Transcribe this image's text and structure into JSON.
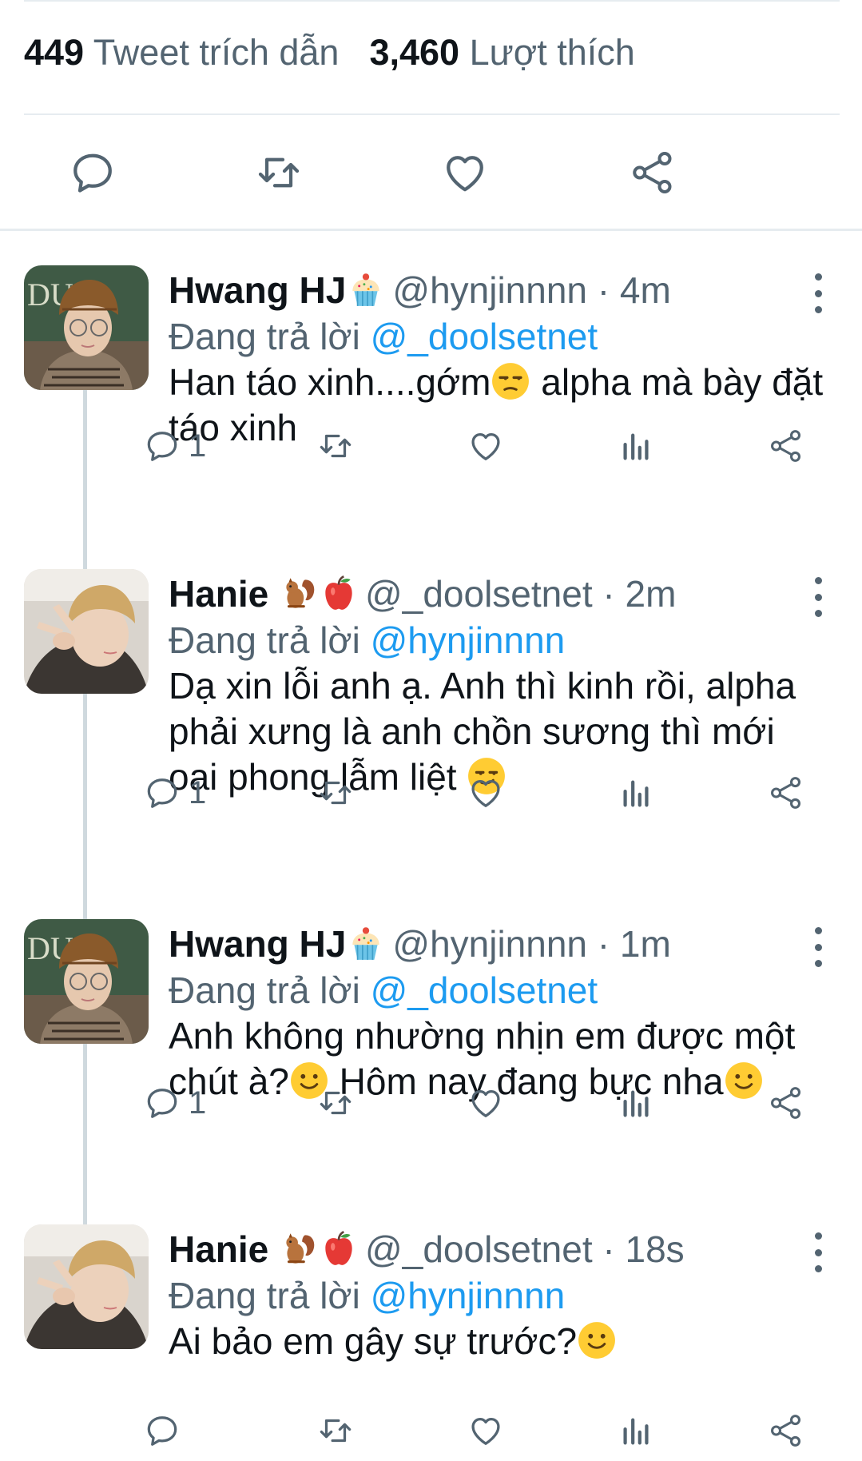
{
  "stats": {
    "quote_count": "449",
    "quote_label": "Tweet trích dẫn",
    "like_count": "3,460",
    "like_label": "Lượt thích"
  },
  "reply_prefix": "Đang trả lời",
  "colors": {
    "accent": "#1d9bf0",
    "muted": "#536471",
    "text": "#0f1419",
    "divider": "#e6ecf0"
  },
  "tweets": [
    {
      "name": "Hwang HJ",
      "name_emoji": "cupcake-icon",
      "handle": "@hynjinnnn · 4m",
      "reply_to": "@_doolsetnet",
      "text_a": "Han táo xinh....gớm",
      "text_b": " alpha mà bày đặt táo xinh",
      "reply_count": "1"
    },
    {
      "name": "Hanie",
      "name_emoji": "squirrel-apple-icon",
      "handle": "@_doolsetnet · 2m",
      "reply_to": "@hynjinnnn",
      "text_a": "Dạ xin lỗi anh ạ. Anh thì kinh rồi, alpha phải xưng là anh chồn sương thì mới oai phong lẫm liệt ",
      "reply_count": "1"
    },
    {
      "name": "Hwang HJ",
      "name_emoji": "cupcake-icon",
      "handle": "@hynjinnnn · 1m",
      "reply_to": "@_doolsetnet",
      "text_a": "Anh không nhường nhịn em được một chút à?",
      "text_b": " Hôm nay đang bực nha",
      "reply_count": "1"
    },
    {
      "name": "Hanie",
      "name_emoji": "squirrel-apple-icon",
      "handle": "@_doolsetnet · 18s",
      "reply_to": "@hynjinnnn",
      "text_a": "Ai bảo em gây sự trước?",
      "reply_count": ""
    }
  ]
}
